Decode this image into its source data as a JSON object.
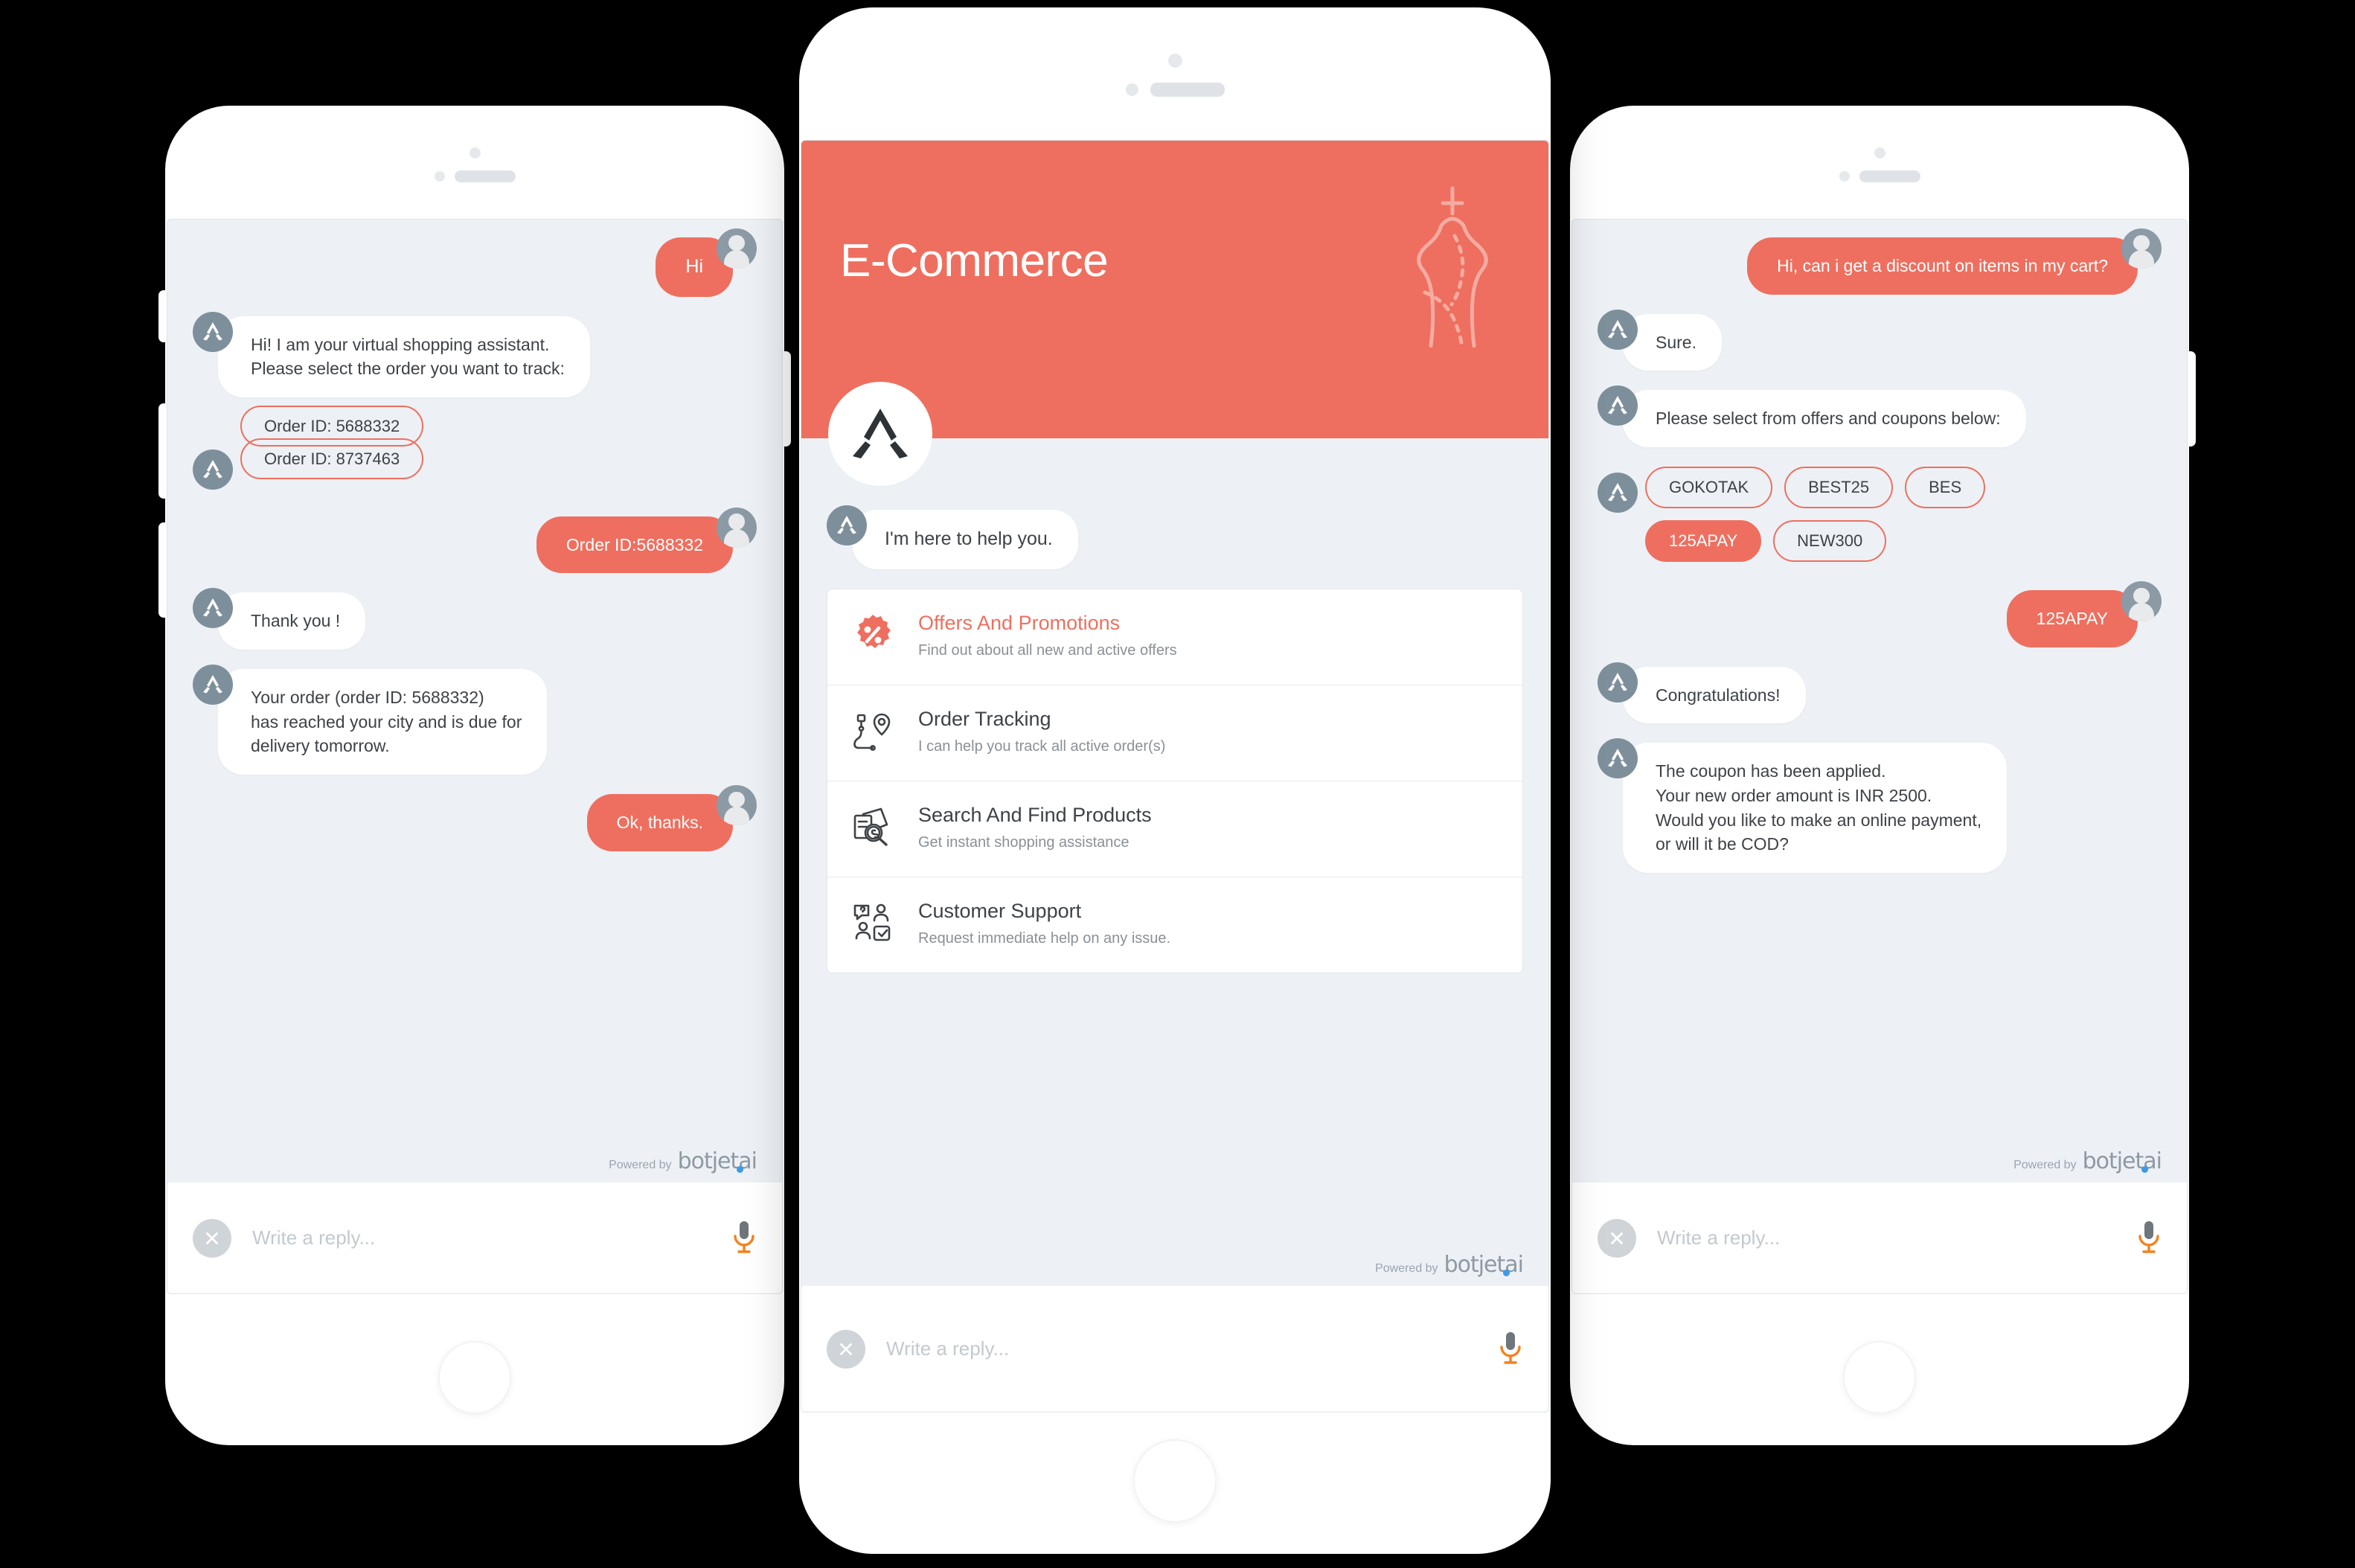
{
  "brand": {
    "accent": "#ee6f5f",
    "bot_avatar_bg": "#7e8f9c",
    "chat_bg": "#edf1f5",
    "powered_by_label": "Powered by",
    "powered_by_logo": "botjet",
    "powered_by_logo_suffix": "ai"
  },
  "input_bar": {
    "placeholder": "Write a reply...",
    "close_icon": "close-icon",
    "mic_icon": "microphone-icon"
  },
  "left_phone": {
    "name": "order-tracking-conversation",
    "messages": [
      {
        "sender": "user",
        "text": "Hi"
      },
      {
        "sender": "bot",
        "text": "Hi! I am your virtual shopping assistant.\nPlease select the order you want to track:"
      },
      {
        "sender": "bot",
        "type": "chips",
        "chips": [
          {
            "label": "Order ID: 5688332",
            "selected": false
          },
          {
            "label": "Order ID: 8737463",
            "selected": false
          }
        ]
      },
      {
        "sender": "user",
        "text": "Order ID:5688332"
      },
      {
        "sender": "bot",
        "text": "Thank you !"
      },
      {
        "sender": "bot",
        "text": "Your order (order ID: 5688332)\nhas reached your city and is due for\ndelivery tomorrow."
      },
      {
        "sender": "user",
        "text": "Ok, thanks."
      }
    ]
  },
  "center_phone": {
    "name": "e-commerce-bot-home",
    "header": {
      "title": "E-Commerce",
      "decor_icon": "mannequin-icon",
      "hero_avatar_icon": "botjet-logo-icon"
    },
    "greeting": "I'm here to help you.",
    "menu": [
      {
        "icon": "discount-badge-icon",
        "title": "Offers And Promotions",
        "subtitle": "Find out about all new and active offers",
        "accent": true
      },
      {
        "icon": "route-pin-icon",
        "title": "Order Tracking",
        "subtitle": "I can help you track all active order(s)",
        "accent": false
      },
      {
        "icon": "search-documents-icon",
        "title": "Search And Find Products",
        "subtitle": "Get instant shopping assistance",
        "accent": false
      },
      {
        "icon": "customer-support-icon",
        "title": "Customer Support",
        "subtitle": "Request immediate help on any issue.",
        "accent": false
      }
    ]
  },
  "right_phone": {
    "name": "discount-coupon-conversation",
    "messages": [
      {
        "sender": "user",
        "text": "Hi, can i get a discount on items in my cart?"
      },
      {
        "sender": "bot",
        "text": "Sure."
      },
      {
        "sender": "bot",
        "text": "Please select from offers and coupons below:"
      },
      {
        "sender": "bot",
        "type": "chips",
        "chips": [
          {
            "label": "GOKOTAK",
            "selected": false
          },
          {
            "label": "BEST25",
            "selected": false
          },
          {
            "label": "BES",
            "selected": false
          },
          {
            "label": "125APAY",
            "selected": true
          },
          {
            "label": "NEW300",
            "selected": false
          }
        ]
      },
      {
        "sender": "user",
        "text": "125APAY"
      },
      {
        "sender": "bot",
        "text": "Congratulations!"
      },
      {
        "sender": "bot",
        "text": "The coupon has been applied.\nYour new order amount is INR 2500.\nWould you like to make an online payment,\nor will it be COD?"
      }
    ]
  }
}
